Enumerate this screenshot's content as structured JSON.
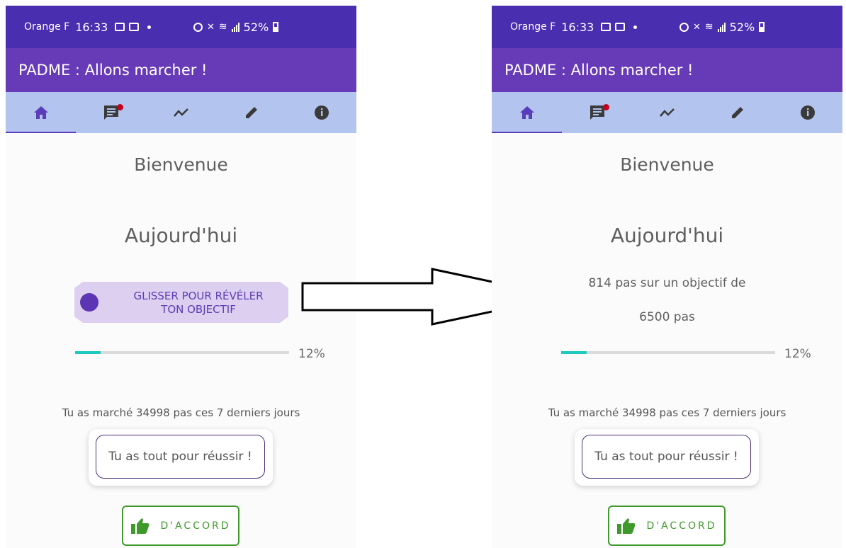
{
  "status_bar": {
    "carrier": "Orange F",
    "time": "16:33",
    "battery": "52%"
  },
  "app_bar": {
    "title": "PADME : Allons marcher !"
  },
  "tabs": [
    {
      "icon": "home-icon",
      "selected": true
    },
    {
      "icon": "chat-icon",
      "badge": true
    },
    {
      "icon": "trend-icon"
    },
    {
      "icon": "edit-icon"
    },
    {
      "icon": "info-icon"
    }
  ],
  "left_screen": {
    "welcome": "Bienvenue",
    "today": "Aujourd'hui",
    "slider_text_line1": "GLISSER POUR RÉVÉLER",
    "slider_text_line2": "TON OBJECTIF",
    "progress_percent": 12,
    "progress_label": "12%",
    "summary": "Tu as marché 34998 pas ces 7 derniers jours",
    "motivation": "Tu as tout pour réussir !",
    "ok_label": "D'ACCORD"
  },
  "right_screen": {
    "welcome": "Bienvenue",
    "today": "Aujourd'hui",
    "steps_line1": "814 pas sur un objectif de",
    "steps_line2": "6500 pas",
    "progress_percent": 12,
    "progress_label": "12%",
    "summary": "Tu as marché 34998 pas ces 7 derniers jours",
    "motivation": "Tu as tout pour réussir !",
    "ok_label": "D'ACCORD"
  },
  "colors": {
    "status_bar": "#4a2eb0",
    "app_bar": "#673ab7",
    "tab_bar": "#b3c5ee",
    "progress": "#1fc8c0",
    "ok_green": "#3f9a2b"
  }
}
